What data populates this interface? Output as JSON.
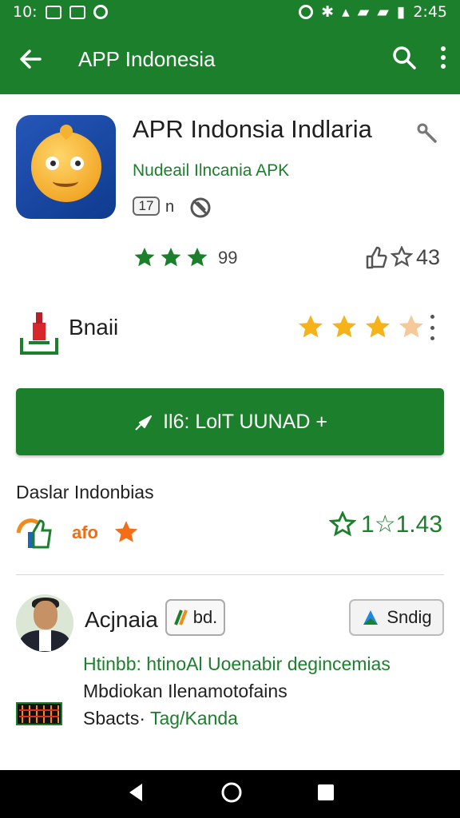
{
  "status_bar": {
    "time_left": "10:",
    "time_right": "2:45"
  },
  "app_bar": {
    "title": "APP Indonesia"
  },
  "app": {
    "title": "APR Indonsia Indlaria",
    "subtitle": "Nudeail Ilncania APK",
    "age_badge": "17",
    "age_suffix": "n",
    "rating_count": "99",
    "likes_count": "43"
  },
  "developer": {
    "name": "Bnaii",
    "rating": 3.5
  },
  "install_button": {
    "label": "Il6: LolT UUNAD +"
  },
  "section": {
    "title": "Daslar Indonbias",
    "badge_text": "afo",
    "rating_value": "1☆1.43"
  },
  "review": {
    "name": "Acjnaia",
    "chip1_label": "bd.",
    "chip2_label": "Sndig",
    "line1": "Htinbb: htinoAl Uoenabir degincemias",
    "line2": "Mbdiokan Ilenamotofains",
    "line3_prefix": "Sbacts·",
    "line3_highlight": "Tag/Kanda"
  },
  "colors": {
    "primary_green": "#1b7f2b",
    "star_yellow": "#f6b21b"
  }
}
